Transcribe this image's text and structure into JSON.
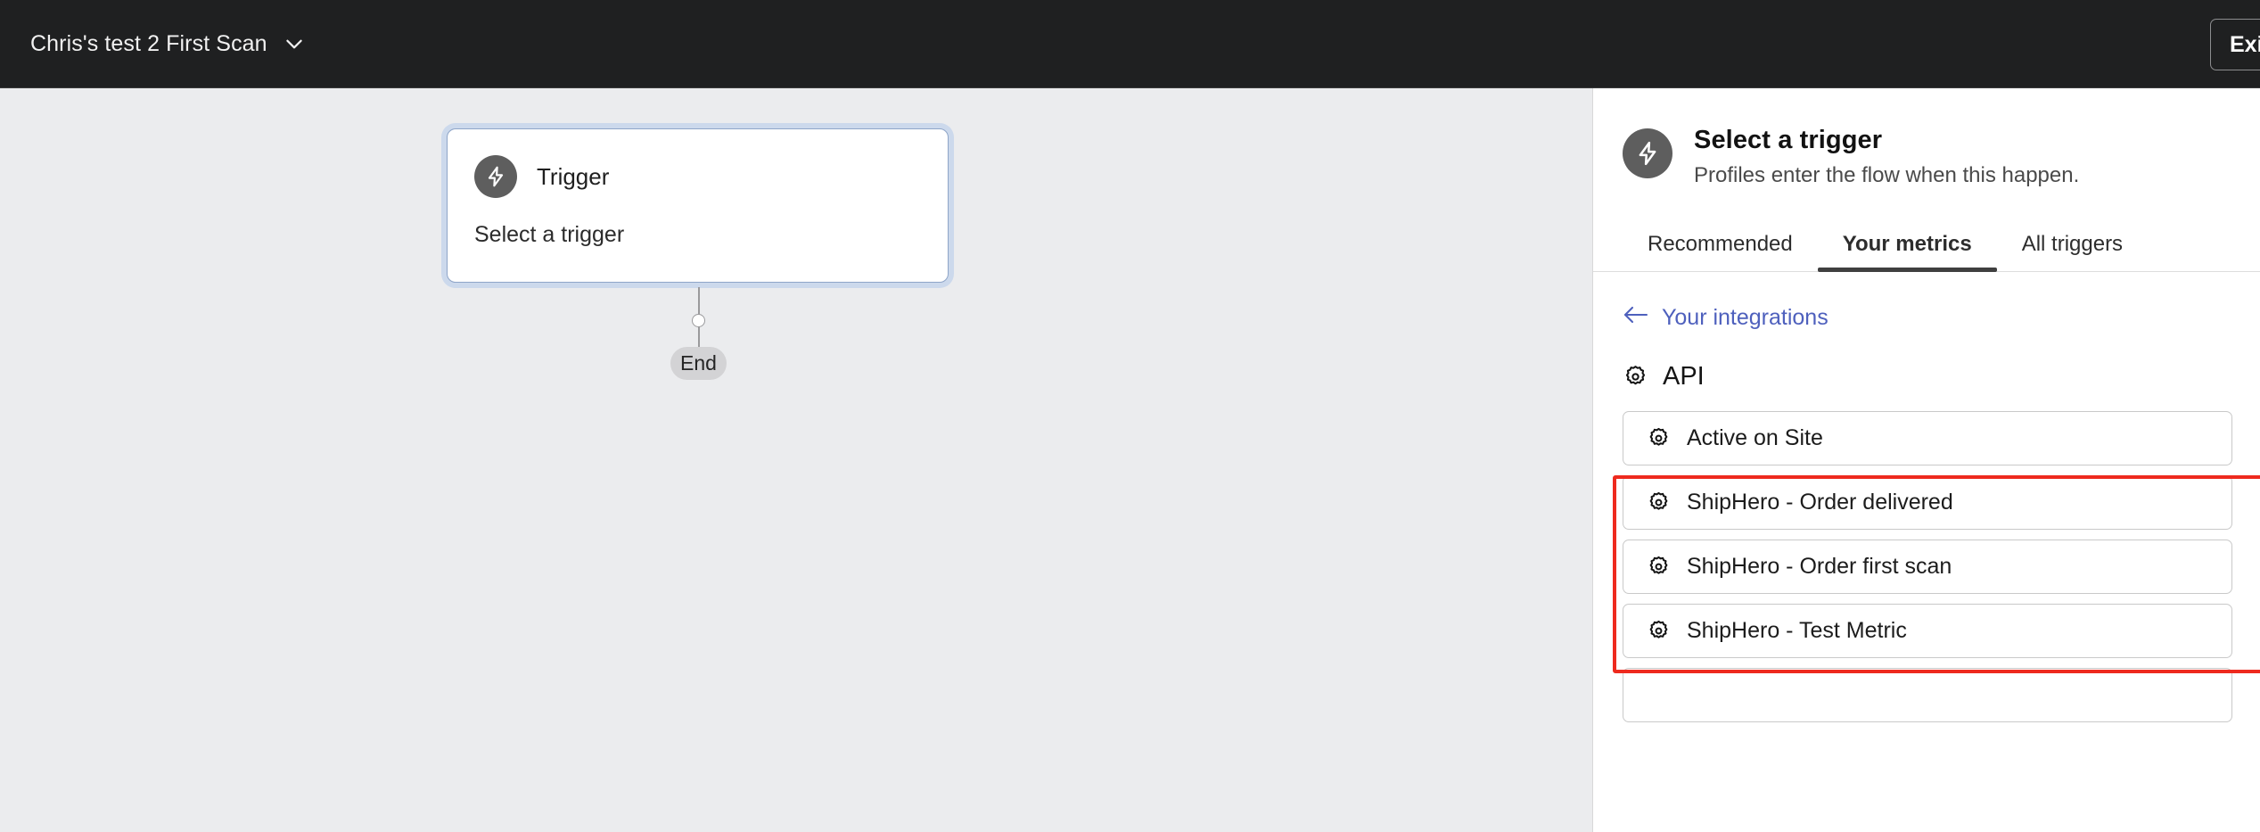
{
  "topbar": {
    "flow_title": "Chris's test 2 First Scan",
    "dropdown_icon": "chevron-down-icon",
    "exit_label": "Exit",
    "background": "#1f2021"
  },
  "canvas": {
    "background": "#ebecee",
    "trigger_node": {
      "icon": "lightning-bolt-icon",
      "title": "Trigger",
      "subtitle": "Select a trigger",
      "selected": true,
      "selection_ring_color": "#ccd9ec"
    },
    "end_node": {
      "label": "End",
      "background": "#d3d3d5"
    }
  },
  "panel": {
    "header": {
      "icon": "lightning-bolt-icon",
      "title": "Select a trigger",
      "subtitle": "Profiles enter the flow when this happen."
    },
    "tabs": [
      {
        "label": "Recommended",
        "active": false
      },
      {
        "label": "Your metrics",
        "active": true
      },
      {
        "label": "All triggers",
        "active": false
      }
    ],
    "back_link": {
      "icon": "arrow-left-icon",
      "label": "Your integrations",
      "color": "#4e60bd"
    },
    "section": {
      "icon": "gear-icon",
      "title": "API"
    },
    "metrics": [
      {
        "icon": "gear-icon",
        "label": "Active on Site",
        "highlighted": false
      },
      {
        "icon": "gear-icon",
        "label": "ShipHero - Order delivered",
        "highlighted": true
      },
      {
        "icon": "gear-icon",
        "label": "ShipHero - Order first scan",
        "highlighted": true
      },
      {
        "icon": "gear-icon",
        "label": "ShipHero - Test Metric",
        "highlighted": true
      },
      {
        "icon": "gear-icon",
        "label": "",
        "highlighted": false
      }
    ],
    "annotation": {
      "type": "rectangle-highlight",
      "color": "#ee2a1e"
    }
  }
}
